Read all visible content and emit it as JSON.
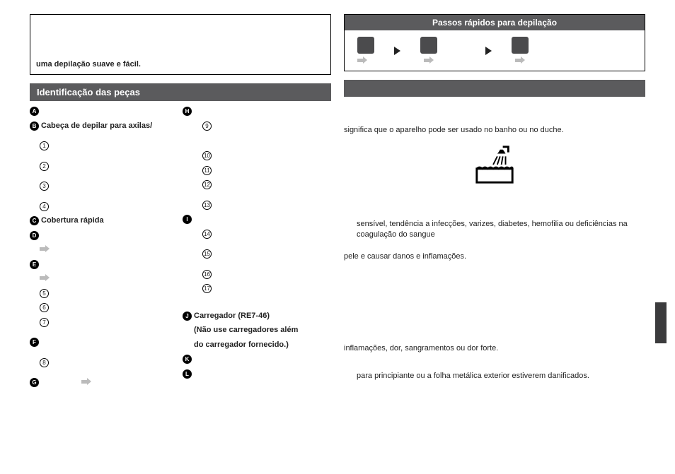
{
  "left": {
    "box_text": "uma depilação suave e fácil.",
    "section_header": "Identificação das peças",
    "parts": {
      "colA": {
        "A": {
          "letter": "A",
          "text": ""
        },
        "B": {
          "letter": "B",
          "text": "Cabeça de depilar para axilas/"
        },
        "n1": {
          "num": "1",
          "text": ""
        },
        "n2": {
          "num": "2",
          "text": ""
        },
        "n3": {
          "num": "3",
          "text": ""
        },
        "n4": {
          "num": "4",
          "text": ""
        },
        "C": {
          "letter": "C",
          "text": "Cobertura rápida"
        },
        "D": {
          "letter": "D",
          "text": ""
        },
        "E": {
          "letter": "E",
          "text": ""
        },
        "n5": {
          "num": "5",
          "text": ""
        },
        "n6": {
          "num": "6",
          "text": ""
        },
        "n7": {
          "num": "7",
          "text": ""
        },
        "F": {
          "letter": "F",
          "text": ""
        },
        "n8": {
          "num": "8",
          "text": ""
        },
        "G": {
          "letter": "G",
          "text": ""
        }
      },
      "colB": {
        "H": {
          "letter": "H",
          "text": ""
        },
        "n9": {
          "num": "9",
          "text": ""
        },
        "n10": {
          "num": "10",
          "text": ""
        },
        "n11": {
          "num": "11",
          "text": ""
        },
        "n12": {
          "num": "12",
          "text": ""
        },
        "n13": {
          "num": "13",
          "text": ""
        },
        "I": {
          "letter": "I",
          "text": ""
        },
        "n14": {
          "num": "14",
          "text": ""
        },
        "n15": {
          "num": "15",
          "text": ""
        },
        "n16": {
          "num": "16",
          "text": ""
        },
        "n17": {
          "num": "17",
          "text": ""
        },
        "J": {
          "letter": "J",
          "text": "Carregador (RE7-46)"
        },
        "J2": "(Não use carregadores além",
        "J3": "do carregador fornecido.)",
        "K": {
          "letter": "K",
          "text": ""
        },
        "L": {
          "letter": "L",
          "text": ""
        }
      }
    }
  },
  "right": {
    "qsteps_header": "Passos rápidos para depilação",
    "p1": "significa que o aparelho pode ser usado no banho ou no duche.",
    "p2": "sensível, tendência a infecções, varizes, diabetes, hemofilia ou deficiências na coagulação do sangue",
    "p3": "pele e causar danos e inflamações.",
    "p4": "inflamações, dor, sangramentos ou dor forte.",
    "p5": "para principiante ou a folha metálica exterior estiverem danificados."
  }
}
